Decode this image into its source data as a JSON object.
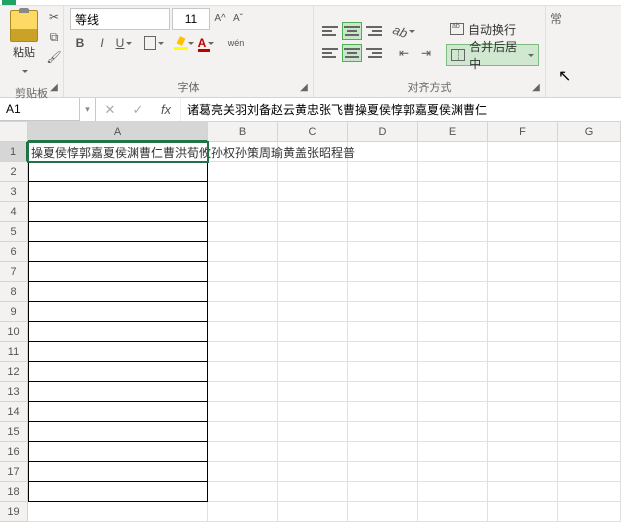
{
  "ribbon": {
    "clipboard": {
      "label": "剪贴板",
      "paste": "粘贴"
    },
    "font": {
      "label": "字体",
      "name": "等线",
      "size": "11",
      "bold": "B",
      "italic": "I",
      "underline": "U",
      "ruby": "wén",
      "fontcolor": "A"
    },
    "alignment": {
      "label": "对齐方式",
      "wrap": "自动换行",
      "merge": "合并后居中"
    },
    "rightStub": "常"
  },
  "namebox": "A1",
  "formula": "诸葛亮关羽刘备赵云黄忠张飞曹操夏侯惇郭嘉夏侯渊曹仁",
  "columns": [
    "A",
    "B",
    "C",
    "D",
    "E",
    "F",
    "G"
  ],
  "rows": [
    "1",
    "2",
    "3",
    "4",
    "5",
    "6",
    "7",
    "8",
    "9",
    "10",
    "11",
    "12",
    "13",
    "14",
    "15",
    "16",
    "17",
    "18",
    "19"
  ],
  "cellA1": "操夏侯惇郭嘉夏侯渊曹仁曹洪荀攸孙权孙策周瑜黄盖张昭程普"
}
